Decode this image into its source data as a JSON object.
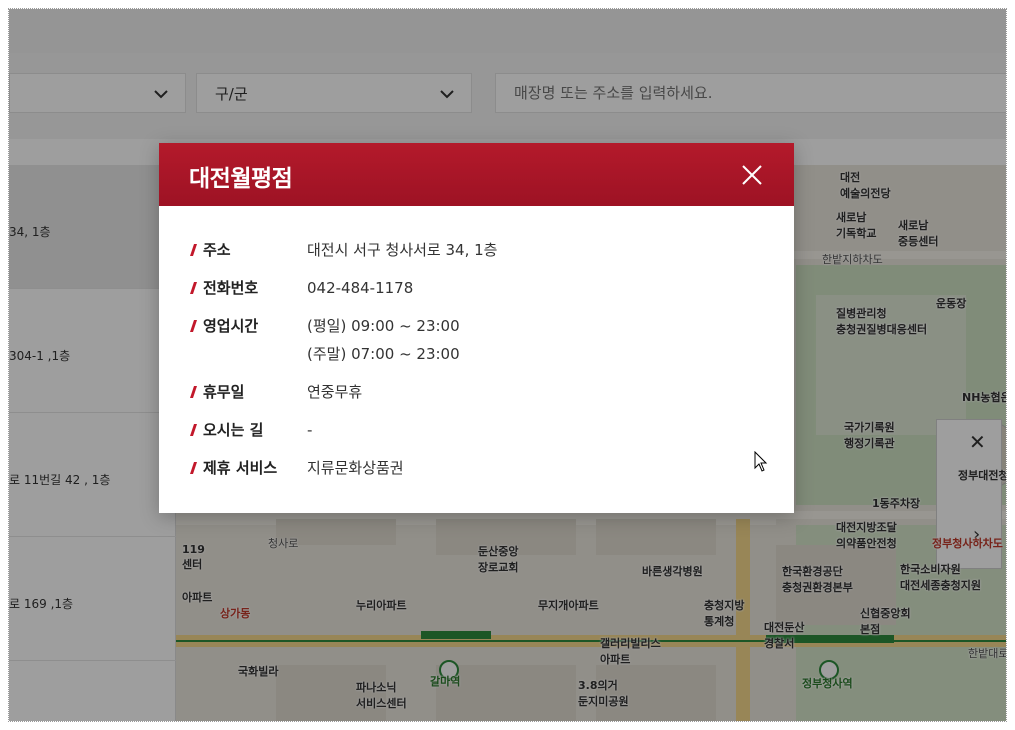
{
  "filters": {
    "sido_selected": "",
    "gugun_selected": "구/군",
    "search_placeholder": "매장명 또는 주소를 입력하세요."
  },
  "store_list": [
    {
      "address_fragment": "34, 1층"
    },
    {
      "address_fragment": "304-1 ,1층"
    },
    {
      "address_fragment": "로 11번길 42 , 1층"
    },
    {
      "address_fragment": "로 169 ,1층"
    }
  ],
  "map_labels": {
    "art_center": "대전\n예술의전당",
    "church": "새로남\n기독학교",
    "school": "새로남\n중등센터",
    "underpass": "한밭지하차도",
    "field": "운동장",
    "hospital_center": "질병관리청\n충청권질병대응센터",
    "nh_bank": "NH농협은",
    "records": "국가기록원\n행정기록관",
    "gov_complex": "정부대전청",
    "parking": "1동주차장",
    "finance": "대전지방조달\n의약품안전청",
    "station_exit": "정부청사하차도",
    "cheongsaro": "청사로",
    "center_119": "119\n센터",
    "dunsan_church": "둔산중앙\n장로교회",
    "bareun_hospital": "바른생각병원",
    "env_corp": "한국환경공단\n충청권환경본부",
    "consumer": "한국소비자원\n대전세종충청지원",
    "apt1": "누리아파트",
    "apt2": "무지개아파트",
    "stats": "충청지방\n통계청",
    "police": "대전둔산\n경찰서",
    "credit_union": "신협중앙회\n본점",
    "gallery_apt": "갤러리빌리스\n아파트",
    "villa": "국화빌라",
    "service": "파나소닉\n서비스센터",
    "park": "3.8의거\n둔지미공원",
    "galma_station": "갈마역",
    "gov_station": "정부청사역",
    "hanbat_road": "한밭대로",
    "shop": "상가동",
    "apt_left": "아파트"
  },
  "modal": {
    "title": "대전월평점",
    "rows": [
      {
        "label": "주소",
        "values": [
          "대전시 서구 청사서로 34, 1층"
        ]
      },
      {
        "label": "전화번호",
        "values": [
          "042-484-1178"
        ]
      },
      {
        "label": "영업시간",
        "values": [
          "(평일) 09:00 ~ 23:00",
          "(주말) 07:00 ~ 23:00"
        ]
      },
      {
        "label": "휴무일",
        "values": [
          "연중무휴"
        ]
      },
      {
        "label": "오시는 길",
        "values": [
          "-"
        ]
      },
      {
        "label": "제휴 서비스",
        "values": [
          "지류문화상품권"
        ]
      }
    ]
  },
  "colors": {
    "header_red": "#a8172a",
    "accent_mark": "#c2182b"
  },
  "icons": [
    "chevron-down-icon",
    "close-icon",
    "chevron-right-icon",
    "cursor-icon"
  ]
}
